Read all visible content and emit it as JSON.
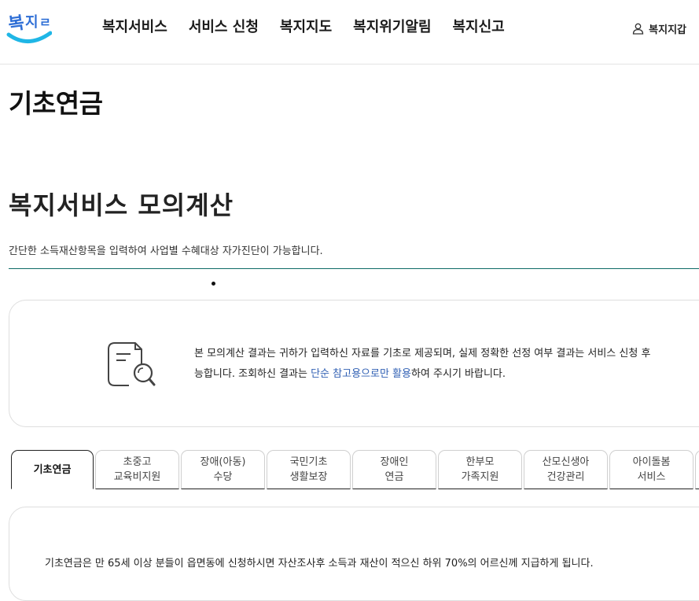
{
  "header": {
    "logo_text": "복지로",
    "nav": [
      "복지서비스",
      "서비스 신청",
      "복지지도",
      "복지위기알림",
      "복지신고"
    ],
    "wallet_label": "복지지갑"
  },
  "page_title": "기초연금",
  "section": {
    "title": "복지서비스 모의계산",
    "intro": "간단한 소득재산항목을 입력하여 사업별 수혜대상 자가진단이 가능합니다."
  },
  "notice": {
    "icon": "document-search-icon",
    "line1": "본 모의계산 결과는 귀하가 입력하신 자료를 기초로 제공되며, 실제 정확한 선정 여부 결과는 서비스 신청 후",
    "line2_pre": "능합니다. 조회하신 결과는 ",
    "line2_highlight": "단순 참고용으로만 활용",
    "line2_post": "하여 주시기 바랍니다."
  },
  "tabs": [
    {
      "label": "기초연금",
      "active": true
    },
    {
      "label": "초중고\n교육비지원",
      "active": false
    },
    {
      "label": "장애(아동)\n수당",
      "active": false
    },
    {
      "label": "국민기초\n생활보장",
      "active": false
    },
    {
      "label": "장애인\n연금",
      "active": false
    },
    {
      "label": "한부모\n가족지원",
      "active": false
    },
    {
      "label": "산모신생아\n건강관리",
      "active": false
    },
    {
      "label": "아이돌봄\n서비스",
      "active": false
    }
  ],
  "content": {
    "text": "기초연금은 만 65세 이상 분들이 읍면동에 신청하시면 자산조사후 소득과 재산이 적으신 하위 70%의 어르신께 지급하게 됩니다."
  },
  "colors": {
    "brand_blue": "#2f6fd6",
    "brand_cyan": "#1fb6e6",
    "divider_teal": "#0e6b67",
    "highlight_blue": "#2f5fb3"
  }
}
